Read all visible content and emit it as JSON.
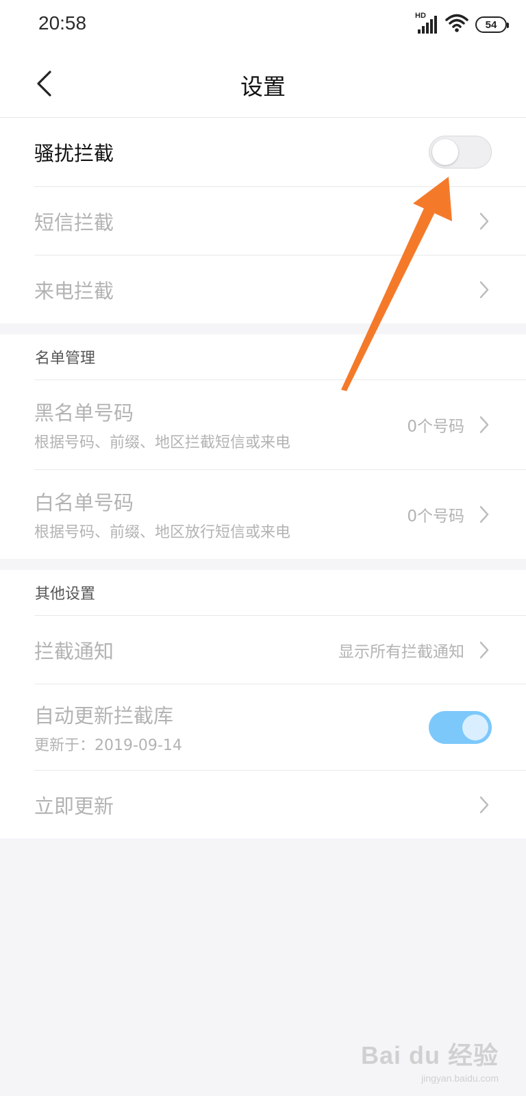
{
  "status_bar": {
    "time": "20:58",
    "network_label": "HD",
    "battery": "54",
    "icons": [
      "signal-icon",
      "wifi-icon",
      "battery-icon"
    ]
  },
  "header": {
    "title": "设置"
  },
  "section_block": {
    "rows": [
      {
        "title": "骚扰拦截",
        "toggle_on": false
      },
      {
        "title": "短信拦截"
      },
      {
        "title": "来电拦截"
      }
    ]
  },
  "list_management": {
    "header": "名单管理",
    "rows": [
      {
        "title": "黑名单号码",
        "subtitle": "根据号码、前缀、地区拦截短信或来电",
        "value": "0个号码"
      },
      {
        "title": "白名单号码",
        "subtitle": "根据号码、前缀、地区放行短信或来电",
        "value": "0个号码"
      }
    ]
  },
  "other_settings": {
    "header": "其他设置",
    "rows": [
      {
        "title": "拦截通知",
        "value": "显示所有拦截通知"
      },
      {
        "title": "自动更新拦截库",
        "subtitle": "更新于：2019-09-14",
        "toggle_on": true
      },
      {
        "title": "立即更新"
      }
    ]
  },
  "colors": {
    "annotation_arrow": "#f47a2a",
    "toggle_on": "#7cc8fb",
    "background": "#f5f4f7"
  },
  "watermark": {
    "main": "Bai du 经验",
    "sub": "jingyan.baidu.com"
  }
}
